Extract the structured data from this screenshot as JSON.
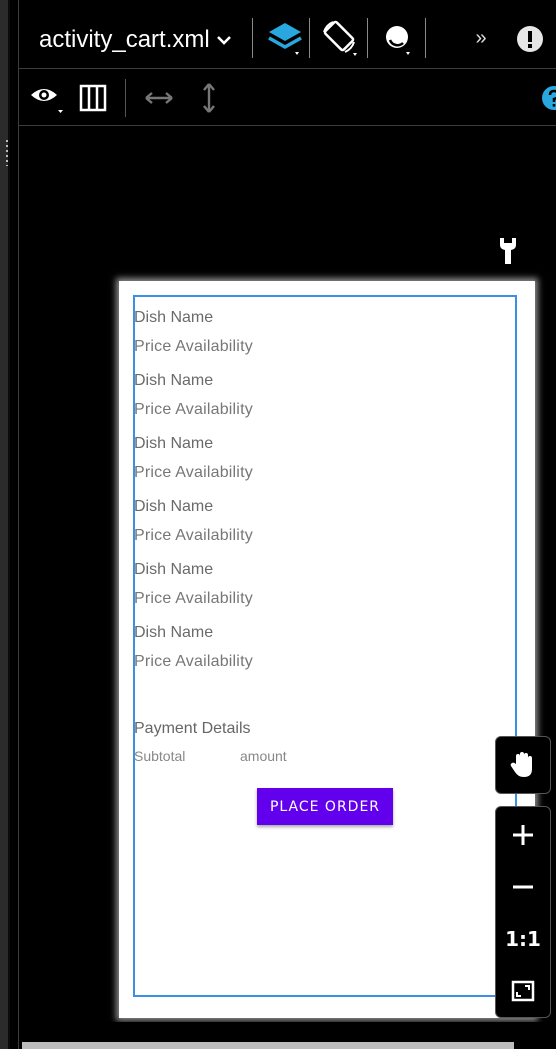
{
  "toolbar": {
    "file_name": "activity_cart.xml",
    "more_label": "»",
    "colors": {
      "accent": "#29a8e0",
      "separator": "#8a8a8a"
    }
  },
  "design_toolbar": {
    "icons": [
      "eye-icon",
      "blueprint-icon",
      "horizontal-resize-icon",
      "vertical-resize-icon",
      "help-icon"
    ]
  },
  "preview": {
    "items": [
      {
        "name": "Dish Name",
        "details": "Price  Availability"
      },
      {
        "name": "Dish Name",
        "details": "Price  Availability"
      },
      {
        "name": "Dish Name",
        "details": "Price  Availability"
      },
      {
        "name": "Dish Name",
        "details": "Price  Availability"
      },
      {
        "name": "Dish Name",
        "details": "Price  Availability"
      },
      {
        "name": "Dish Name",
        "details": "Price  Availability"
      }
    ],
    "payment_title": "Payment Details",
    "subtotal_label": "Subtotal",
    "amount_label": "amount",
    "place_order": "PLACE ORDER",
    "colors": {
      "button": "#6200ee",
      "selection_border": "#3d8fe6"
    }
  },
  "zoom_controls": {
    "actual_size_label": "1:1",
    "icons": [
      "pan-hand-icon",
      "zoom-in-icon",
      "zoom-out-icon",
      "fit-screen-icon"
    ]
  }
}
